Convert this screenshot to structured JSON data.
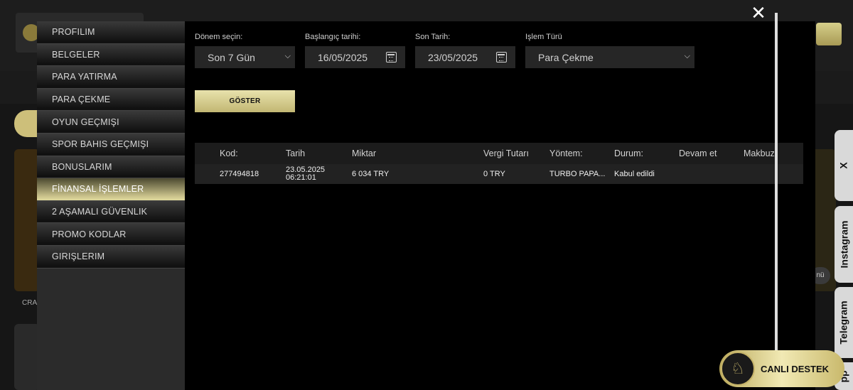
{
  "background": {
    "crash_label": "CRA",
    "menu_label": "nü"
  },
  "side_tabs": {
    "close": "X",
    "instagram": "Instagram",
    "telegram": "Telegram",
    "app": "pp"
  },
  "sidebar": {
    "items": [
      {
        "label": "PROFILIM"
      },
      {
        "label": "BELGELER"
      },
      {
        "label": "PARA YATIRMA"
      },
      {
        "label": "PARA ÇEKME"
      },
      {
        "label": "OYUN GEÇMIŞI"
      },
      {
        "label": "SPOR BAHIS GEÇMIŞI"
      },
      {
        "label": "BONUSLARIM"
      },
      {
        "label": "FİNANSAL İŞLEMLER"
      },
      {
        "label": "2 AŞAMALI GÜVENLIK"
      },
      {
        "label": "PROMO KODLAR"
      },
      {
        "label": "GIRIŞLERIM"
      }
    ],
    "active_index": 7
  },
  "filters": {
    "period_label": "Dönem seçin:",
    "period_value": "Son 7 Gün",
    "start_label": "Başlangıç tarihi:",
    "start_value": "16/05/2025",
    "end_label": "Son Tarih:",
    "end_value": "23/05/2025",
    "type_label": "Işlem Türü",
    "type_value": "Para Çekme",
    "show_button": "GÖSTER"
  },
  "table": {
    "headers": [
      "Kod:",
      "Tarih",
      "Miktar",
      "Vergi Tutarı",
      "Yöntem:",
      "Durum:",
      "Devam et",
      "Makbuz:"
    ],
    "rows": [
      {
        "code": "277494818",
        "date": "23.05.2025",
        "time": "06:21:01",
        "amount": "6 034 TRY",
        "tax": "0 TRY",
        "method": "TURBO PAPA...",
        "status": "Kabul edildi",
        "continue": "",
        "receipt": ""
      }
    ]
  },
  "live_support": {
    "label": "CANLI DESTEK"
  },
  "colors": {
    "accent_gold": "#c8c08a",
    "modal_bg": "#000000",
    "sidebar_bg": "#2b2b2b"
  }
}
